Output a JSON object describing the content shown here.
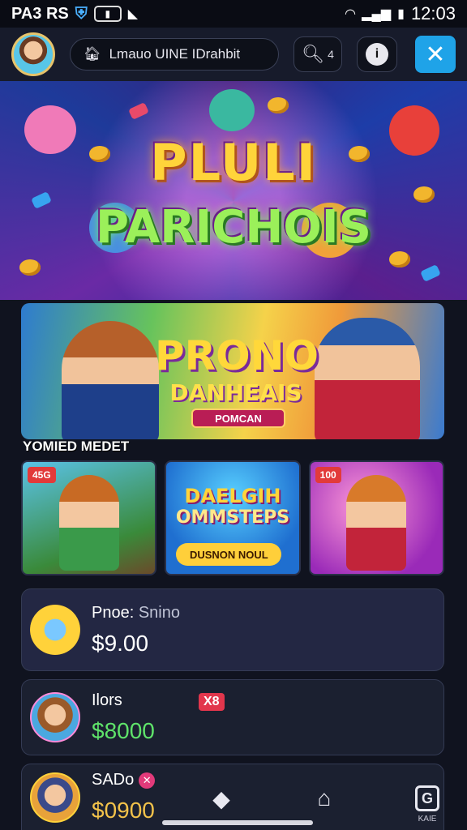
{
  "status_bar": {
    "left_text": "PA3 RS",
    "time": "12:03",
    "icons": [
      "shield-icon",
      "battery-mini-icon",
      "download-icon",
      "wifi-icon",
      "signal-icon",
      "battery-icon"
    ]
  },
  "header": {
    "search_label": "Lmauo UINE IDrahbit",
    "search_button_label": "4",
    "info_icon": "info-icon",
    "close_icon": "close-icon"
  },
  "hero": {
    "title_line1": "PLULI",
    "title_line2": "PARICHOIS"
  },
  "promo": {
    "title_line1": "PRONO",
    "title_line2": "DANHEAIS",
    "button_label": "POMCAN"
  },
  "section": {
    "label": "YOMIED MEDET"
  },
  "game_cards": [
    {
      "badge": "45G"
    },
    {
      "title_line1": "DAELGIH",
      "title_line2": "OMMSTEPS",
      "button_label": "DUSNON NOUL"
    },
    {
      "badge": "100"
    }
  ],
  "rows": [
    {
      "name": "Pnoe:",
      "sub": "Snino",
      "amount": "$9.00",
      "icon": "coin-icon"
    },
    {
      "name": "Ilors",
      "tag": "X8",
      "amount": "$8000",
      "icon": "pet-avatar-icon"
    },
    {
      "name": "SADo",
      "amount": "$0900",
      "icon": "pet-avatar-icon"
    }
  ],
  "bottom_nav": {
    "items": [
      {
        "icon": "crystal-icon",
        "label": ""
      },
      {
        "icon": "house-icon",
        "label": ""
      },
      {
        "icon": "g-icon",
        "label": "KAIE"
      }
    ]
  }
}
